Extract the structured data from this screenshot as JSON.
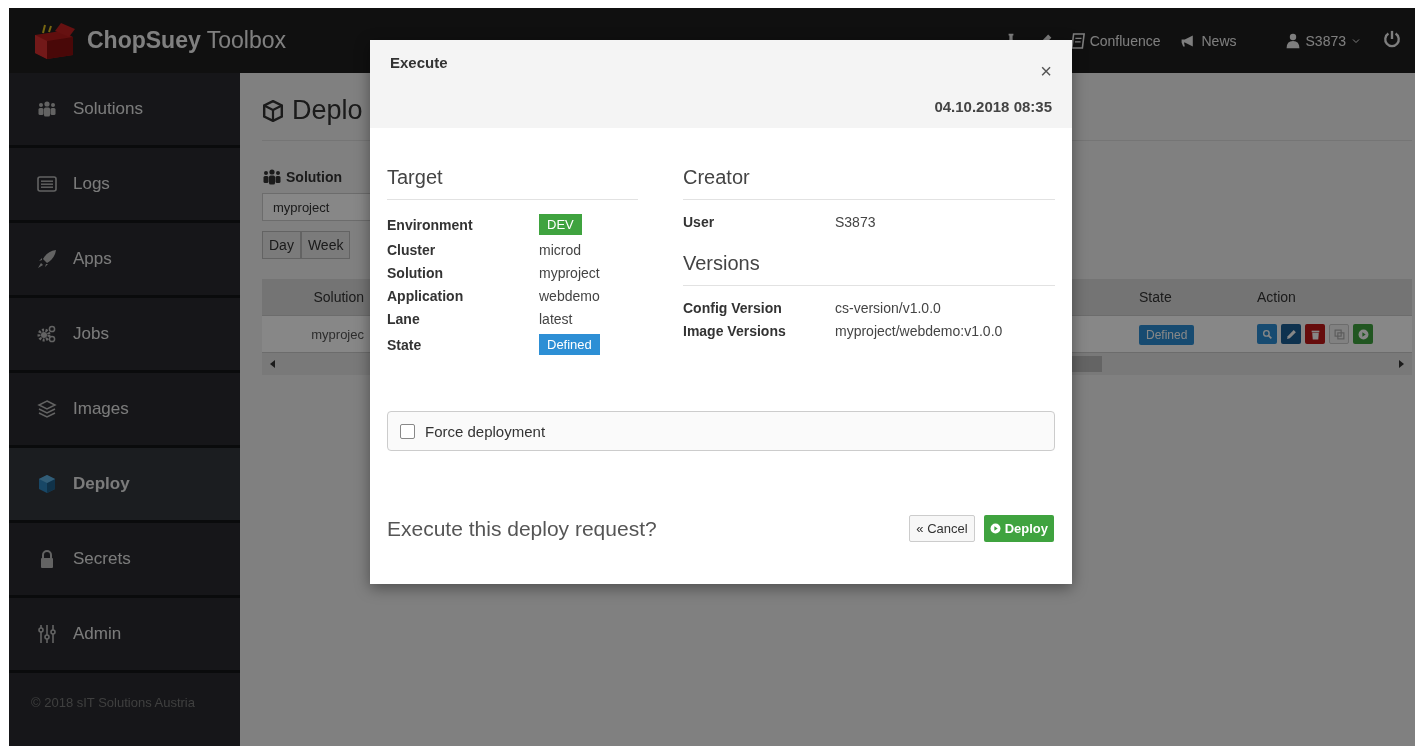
{
  "header": {
    "title": "**ChopSuey** Toolbox",
    "nav": [
      {
        "kind": "flask"
      },
      {
        "kind": "pen"
      },
      {
        "kind": "doc",
        "label": "Confluence"
      },
      {
        "kind": "horn",
        "label": "News"
      }
    ],
    "user": "S3873"
  },
  "sidebar": {
    "items": [
      {
        "kind": "people",
        "label": "Solutions",
        "selected": false
      },
      {
        "kind": "list",
        "label": "Logs",
        "selected": false
      },
      {
        "kind": "rocket",
        "label": "Apps",
        "selected": false
      },
      {
        "kind": "gears",
        "label": "Jobs",
        "selected": false
      },
      {
        "kind": "layers",
        "label": "Images",
        "selected": false
      },
      {
        "kind": "cube",
        "label": "Deploy",
        "selected": true
      },
      {
        "kind": "lock",
        "label": "Secrets",
        "selected": false
      },
      {
        "kind": "sliders",
        "label": "Admin",
        "selected": false
      }
    ],
    "footer": "© 2018 sIT Solutions Austria"
  },
  "page": {
    "title": "Deplo",
    "solution_label": "Solution",
    "solution_value": "myproject",
    "ranges": [
      {
        "label": "Day",
        "selected": false
      },
      {
        "label": "Week",
        "selected": false
      }
    ],
    "table": {
      "columns": [
        "Solution",
        "State",
        "Action"
      ],
      "rows": [
        {
          "solution": "myprojec",
          "state": "Defined"
        }
      ]
    }
  },
  "modal": {
    "title": "Execute",
    "close": "×",
    "date": "04.10.2018 08:35",
    "target": {
      "heading": "Target",
      "rows": [
        {
          "label": "Environment",
          "value": "DEV",
          "kind": "badge",
          "color": "#3fa33f"
        },
        {
          "label": "Cluster",
          "value": "microd",
          "kind": "text"
        },
        {
          "label": "Solution",
          "value": "myproject",
          "kind": "text"
        },
        {
          "label": "Application",
          "value": "webdemo",
          "kind": "text"
        },
        {
          "label": "Lane",
          "value": "latest",
          "kind": "text"
        },
        {
          "label": "State",
          "value": "Defined",
          "kind": "badge",
          "color": "#2d8fd5"
        }
      ]
    },
    "creator": {
      "heading": "Creator",
      "rows": [
        {
          "label": "User",
          "value": "S3873"
        }
      ]
    },
    "versions": {
      "heading": "Versions",
      "rows": [
        {
          "label": "Config Version",
          "value": "cs-version/v1.0.0"
        },
        {
          "label": "Image Versions",
          "value": "myproject/webdemo:v1.0.0"
        }
      ]
    },
    "force": {
      "label": "Force deployment",
      "checked": false
    },
    "question": "Execute this deploy request?",
    "cancel": "« Cancel",
    "confirm": "Deploy"
  }
}
